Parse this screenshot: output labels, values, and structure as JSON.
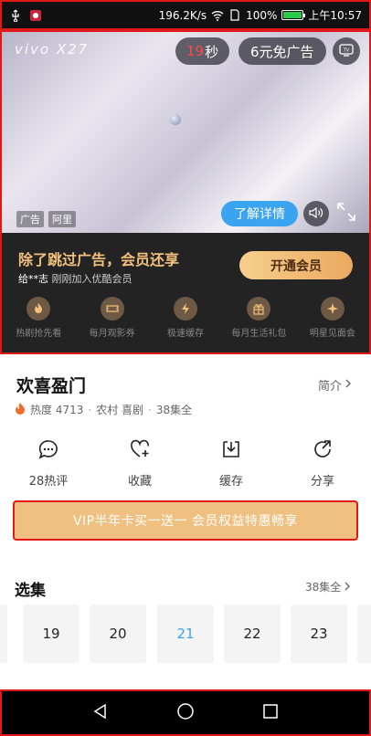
{
  "status_bar": {
    "speed": "196.2K/s",
    "battery_pct": "100%",
    "battery_level": 1.0,
    "time": "上午10:57",
    "icons": [
      "usb-icon",
      "app-notification-icon",
      "wifi-icon",
      "sim-icon",
      "battery-icon"
    ]
  },
  "ad": {
    "brand": "vivo X27",
    "countdown_number": "19",
    "countdown_unit": "秒",
    "skip_label": "6元免广告",
    "tags": [
      "广告",
      "阿里"
    ],
    "learn_more": "了解详情"
  },
  "vip": {
    "headline": "除了跳过广告，会员还享",
    "recent_user": "给**志",
    "recent_text": " 刚刚加入优酷会员",
    "open_button": "开通会员",
    "perks": [
      {
        "label": "热剧抢先看",
        "icon": "drama-icon"
      },
      {
        "label": "每月观影券",
        "icon": "ticket-icon"
      },
      {
        "label": "极速缓存",
        "icon": "lightning-icon"
      },
      {
        "label": "每月生活礼包",
        "icon": "gift-icon"
      },
      {
        "label": "明星见面会",
        "icon": "star-icon"
      }
    ]
  },
  "show": {
    "title": "欢喜盈门",
    "intro_link": "简介",
    "heat_label": "热度 4713",
    "genres": "农村 喜剧",
    "episode_count": "38集全"
  },
  "actions": [
    {
      "label": "28热评",
      "icon": "comment-icon"
    },
    {
      "label": "收藏",
      "icon": "heart-plus-icon"
    },
    {
      "label": "缓存",
      "icon": "download-icon"
    },
    {
      "label": "分享",
      "icon": "share-icon"
    }
  ],
  "promo": {
    "text": "VIP半年卡买一送一  会员权益特惠畅享"
  },
  "episodes": {
    "heading": "选集",
    "all_link": "38集全",
    "items": [
      "19",
      "20",
      "21",
      "22",
      "23"
    ],
    "current": "21"
  },
  "colors": {
    "accent_blue": "#3aa4f0",
    "gold": "#f3c079",
    "highlight_red": "#e01818",
    "countdown_red": "#ff4a4a",
    "promo_bg": "#f0c080"
  }
}
